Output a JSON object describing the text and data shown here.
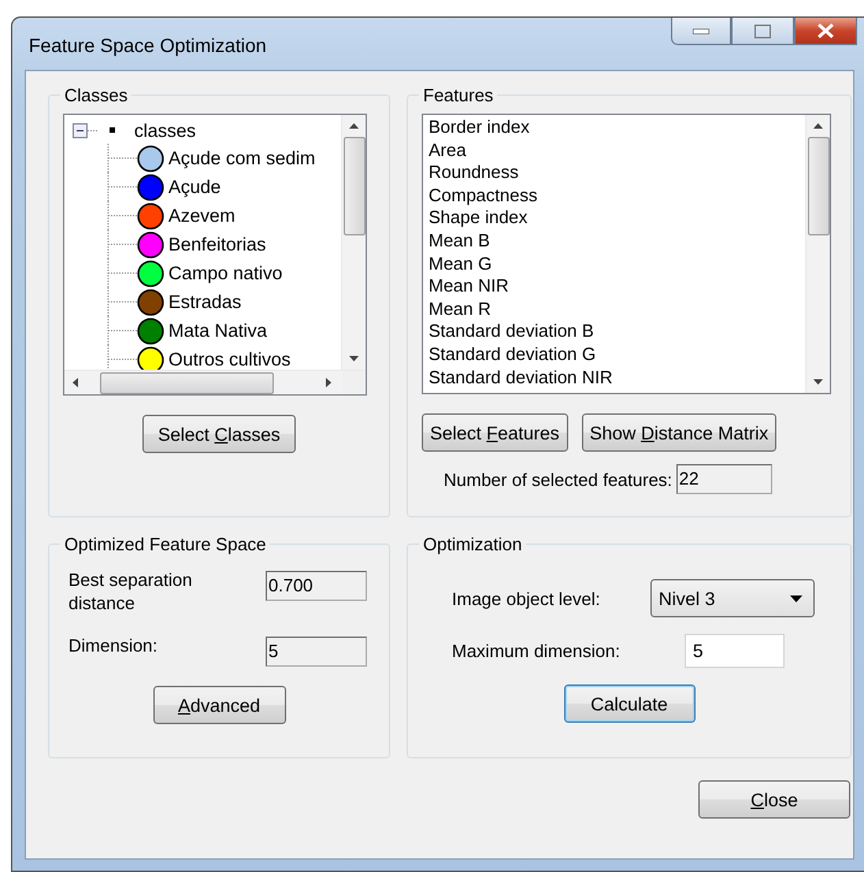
{
  "window": {
    "title": "Feature Space Optimization"
  },
  "classes": {
    "title": "Classes",
    "root": {
      "label": "classes",
      "expanded": true,
      "children": [
        {
          "label": "Açude com sedim",
          "color": "#a8c8ec"
        },
        {
          "label": "Açude",
          "color": "#0000ff"
        },
        {
          "label": "Azevem",
          "color": "#ff4000"
        },
        {
          "label": "Benfeitorias",
          "color": "#ff00ff"
        },
        {
          "label": "Campo nativo",
          "color": "#00ff40"
        },
        {
          "label": "Estradas",
          "color": "#804000"
        },
        {
          "label": "Mata Nativa",
          "color": "#008000"
        },
        {
          "label": "Outros cultivos",
          "color": "#ffff00"
        }
      ]
    },
    "button": {
      "label_start": "Select ",
      "access_key": "C",
      "label_end": "lasses"
    }
  },
  "features": {
    "title": "Features",
    "items": [
      "Border index",
      "Area",
      "Roundness",
      "Compactness",
      "Shape index",
      "Mean B",
      "Mean G",
      "Mean NIR",
      "Mean R",
      "Standard deviation B",
      "Standard deviation G",
      "Standard deviation NIR"
    ],
    "buttons": [
      {
        "label_start": "Select ",
        "access_key": "F",
        "label_end": "eatures"
      },
      {
        "label_start": "Show ",
        "access_key": "D",
        "label_end": "istance Matrix"
      }
    ],
    "count_label": "Number of selected features:",
    "count": "22"
  },
  "optimized": {
    "title": "Optimized Feature Space",
    "fields": [
      {
        "label": "Best separation distance",
        "value": "0.700"
      },
      {
        "label": "Dimension:",
        "value": "5"
      }
    ],
    "button": {
      "access_key": "A",
      "label_end": "dvanced"
    }
  },
  "optimization": {
    "title": "Optimization",
    "level_label": "Image object level:",
    "level_value": "Nivel 3",
    "max_label": "Maximum dimension:",
    "max_value": "5",
    "button": {
      "label": "Calculate",
      "default": true
    }
  },
  "close_button": {
    "access_key": "C",
    "label_end": "lose"
  }
}
